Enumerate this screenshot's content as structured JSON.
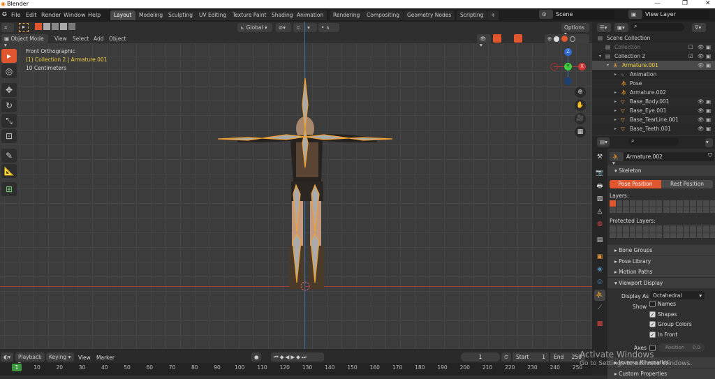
{
  "window": {
    "title": "Blender",
    "controls": [
      "—",
      "❐",
      "✕"
    ]
  },
  "menus": [
    "File",
    "Edit",
    "Render",
    "Window",
    "Help"
  ],
  "workspaces": [
    "Layout",
    "Modeling",
    "Sculpting",
    "UV Editing",
    "Texture Paint",
    "Shading",
    "Animation",
    "Rendering",
    "Compositing",
    "Geometry Nodes",
    "Scripting",
    "+"
  ],
  "active_workspace": "Layout",
  "scene": {
    "label": "Scene",
    "view_layer": "View Layer"
  },
  "tool_header": {
    "orientation": "Global",
    "options": "Options"
  },
  "viewport_header": {
    "mode": "Object Mode",
    "menus": [
      "View",
      "Select",
      "Add",
      "Object"
    ]
  },
  "viewport_info": {
    "view": "Front Orthographic",
    "collection": "(1) Collection 2 | Armature.001",
    "scale": "10 Centimeters"
  },
  "gizmo": {
    "z": "Z",
    "y": "Y",
    "x": "X"
  },
  "outliner": {
    "rows": [
      {
        "label": "Scene Collection",
        "indent": 0,
        "icon": "collection-icon",
        "color": "#ccc"
      },
      {
        "label": "Collection",
        "indent": 1,
        "icon": "collection-icon",
        "color": "#777",
        "checkbox": "☐",
        "vis": true
      },
      {
        "label": "Collection 2",
        "indent": 1,
        "icon": "collection-icon",
        "color": "#ccc",
        "checkbox": "☑",
        "vis": true,
        "expand": "▾"
      },
      {
        "label": "Armature.001",
        "indent": 2,
        "icon": "armature-icon",
        "color": "#f0d040",
        "vis": true,
        "expand": "▾",
        "selected": true
      },
      {
        "label": "Animation",
        "indent": 3,
        "icon": "animation-icon",
        "color": "#ccc",
        "expand": "▸"
      },
      {
        "label": "Pose",
        "indent": 3,
        "icon": "pose-icon",
        "color": "#ccc"
      },
      {
        "label": "Armature.002",
        "indent": 3,
        "icon": "armature-data-icon",
        "color": "#ccc",
        "expand": "▸"
      },
      {
        "label": "Base_Body.001",
        "indent": 3,
        "icon": "mesh-icon",
        "color": "#ccc",
        "expand": "▸",
        "vis": true
      },
      {
        "label": "Base_Eye.001",
        "indent": 3,
        "icon": "mesh-icon",
        "color": "#ccc",
        "expand": "▸",
        "vis": true
      },
      {
        "label": "Base_TearLine.001",
        "indent": 3,
        "icon": "mesh-icon",
        "color": "#ccc",
        "expand": "▸",
        "vis": true
      },
      {
        "label": "Base_Teeth.001",
        "indent": 3,
        "icon": "mesh-icon",
        "color": "#ccc",
        "expand": "▸",
        "vis": true
      }
    ]
  },
  "properties": {
    "data_name": "Armature.002",
    "skeleton": "Skeleton",
    "pose_position": "Pose Position",
    "rest_position": "Rest Position",
    "layers": "Layers:",
    "protected_layers": "Protected Layers:",
    "panels_collapsed": [
      "Bone Groups",
      "Pose Library",
      "Motion Paths"
    ],
    "viewport_display": "Viewport Display",
    "display_as_label": "Display As",
    "display_as_value": "Octahedral",
    "show_label": "Show",
    "show_options": [
      {
        "label": "Names",
        "checked": false
      },
      {
        "label": "Shapes",
        "checked": true
      },
      {
        "label": "Group Colors",
        "checked": true
      },
      {
        "label": "In Front",
        "checked": true
      }
    ],
    "axes_label": "Axes",
    "position_label": "Position",
    "position_value": "0.0",
    "inverse_kinematics": "Inverse Kinematics",
    "custom_properties": "Custom Properties"
  },
  "timeline": {
    "menus": [
      "Playback",
      "Keying",
      "View",
      "Marker"
    ],
    "current_frame": "1",
    "start_label": "Start",
    "start": "1",
    "end_label": "End",
    "end": "250",
    "ticks": [
      "1",
      "10",
      "20",
      "30",
      "40",
      "50",
      "60",
      "70",
      "80",
      "90",
      "100",
      "110",
      "120",
      "130",
      "140",
      "150",
      "160",
      "170",
      "180",
      "190",
      "200",
      "210",
      "220",
      "230",
      "240",
      "250"
    ]
  },
  "watermark": {
    "line1": "Activate Windows",
    "line2": "Go to Settings to activate Windows."
  },
  "colors": {
    "accent": "#e0562f",
    "selected_text": "#f0d040",
    "bone": "#f0a030"
  }
}
